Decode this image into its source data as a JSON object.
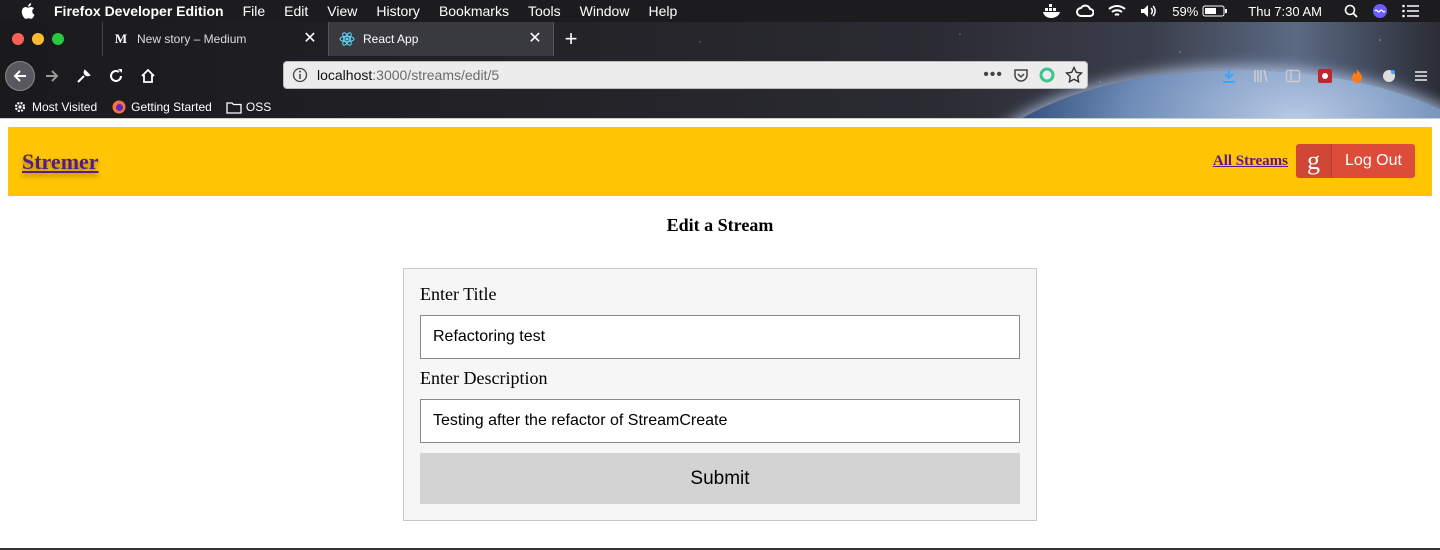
{
  "menubar": {
    "app_name": "Firefox Developer Edition",
    "items": [
      "File",
      "Edit",
      "View",
      "History",
      "Bookmarks",
      "Tools",
      "Window",
      "Help"
    ],
    "battery": "59%",
    "clock": "Thu 7:30 AM"
  },
  "tabs": [
    {
      "title": "New story – Medium",
      "favicon": "M"
    },
    {
      "title": "React App",
      "favicon": "react-icon"
    }
  ],
  "url": {
    "host": "localhost",
    "path": ":3000/streams/edit/5"
  },
  "bookmarks": [
    {
      "label": "Most Visited",
      "icon": "gear-icon"
    },
    {
      "label": "Getting Started",
      "icon": "firefox-icon"
    },
    {
      "label": "OSS",
      "icon": "folder-icon"
    }
  ],
  "colors": {
    "header_bg": "#ffc502",
    "link": "#551a8b",
    "logout_bg": "#dd4b39"
  },
  "header": {
    "brand": "Stremer",
    "all_streams": "All Streams",
    "logout_label": "Log Out"
  },
  "form": {
    "page_title": "Edit a Stream",
    "title_label": "Enter Title",
    "title_value": "Refactoring test",
    "description_label": "Enter Description",
    "description_value": "Testing after the refactor of StreamCreate",
    "submit_label": "Submit"
  }
}
